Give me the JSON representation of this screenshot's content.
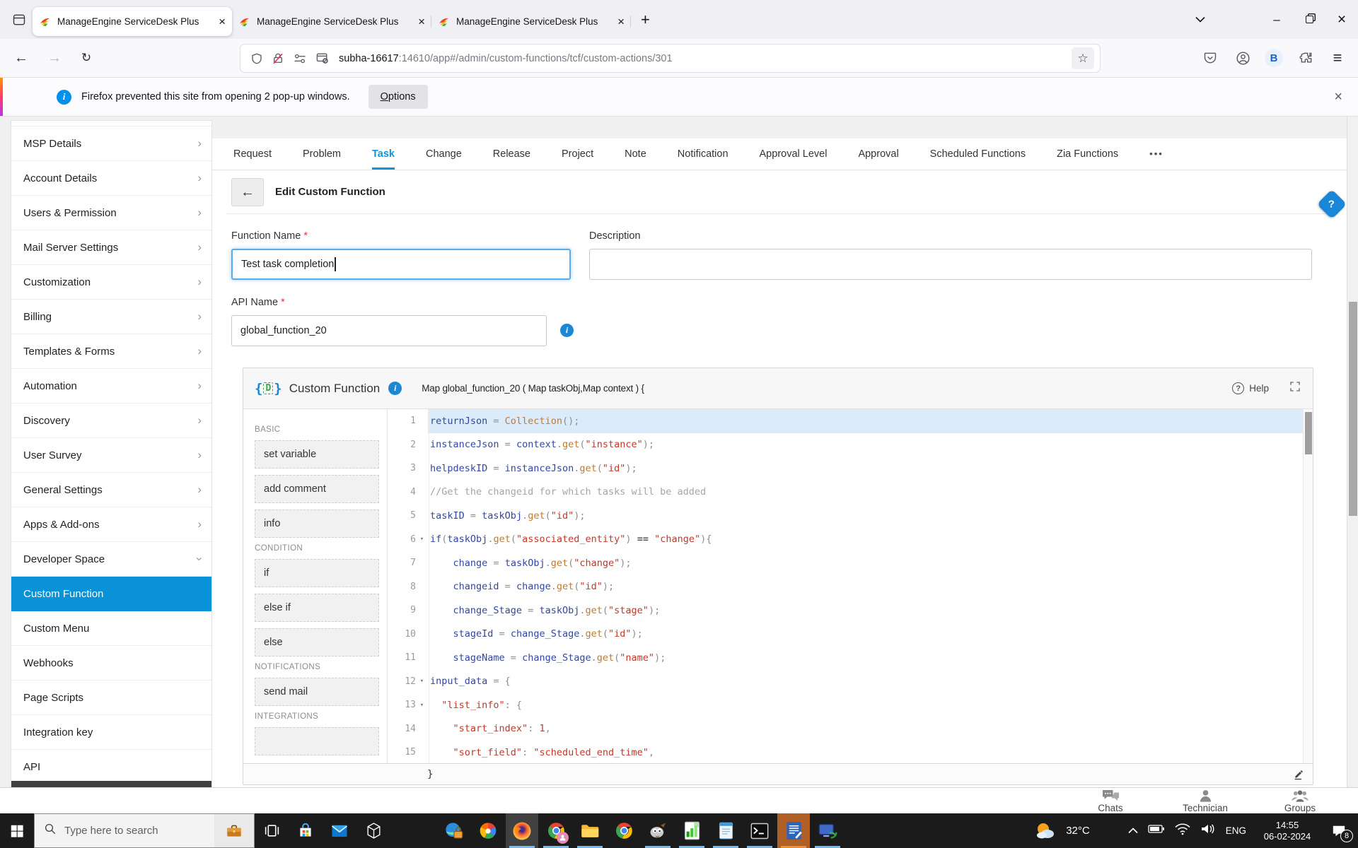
{
  "browser": {
    "tabs": [
      {
        "title": "ManageEngine ServiceDesk Plus",
        "active": true
      },
      {
        "title": "ManageEngine ServiceDesk Plus",
        "active": false
      },
      {
        "title": "ManageEngine ServiceDesk Plus",
        "active": false
      }
    ],
    "new_tab_label": "+",
    "url": {
      "host": "subha-16617",
      "rest": ":14610/app#/admin/custom-functions/tcf/custom-actions/301"
    },
    "notification": {
      "text": "Firefox prevented this site from opening 2 pop-up windows.",
      "options_label": "Options",
      "close_label": "×"
    },
    "window": {
      "minimize": "–",
      "close": "×"
    }
  },
  "sidebar": {
    "items": [
      {
        "label": "MSP Details",
        "chevron": "right"
      },
      {
        "label": "Account Details",
        "chevron": "right"
      },
      {
        "label": "Users & Permission",
        "chevron": "right"
      },
      {
        "label": "Mail Server Settings",
        "chevron": "right"
      },
      {
        "label": "Customization",
        "chevron": "right"
      },
      {
        "label": "Billing",
        "chevron": "right"
      },
      {
        "label": "Templates & Forms",
        "chevron": "right"
      },
      {
        "label": "Automation",
        "chevron": "right"
      },
      {
        "label": "Discovery",
        "chevron": "right"
      },
      {
        "label": "User Survey",
        "chevron": "right"
      },
      {
        "label": "General Settings",
        "chevron": "right"
      },
      {
        "label": "Apps & Add-ons",
        "chevron": "right"
      },
      {
        "label": "Developer Space",
        "chevron": "down"
      },
      {
        "label": "Custom Function",
        "active": true
      },
      {
        "label": "Custom Menu"
      },
      {
        "label": "Webhooks"
      },
      {
        "label": "Page Scripts"
      },
      {
        "label": "Integration key"
      },
      {
        "label": "API"
      }
    ]
  },
  "module_tabs": [
    {
      "label": "Request"
    },
    {
      "label": "Problem"
    },
    {
      "label": "Task",
      "active": true
    },
    {
      "label": "Change"
    },
    {
      "label": "Release"
    },
    {
      "label": "Project"
    },
    {
      "label": "Note"
    },
    {
      "label": "Notification"
    },
    {
      "label": "Approval Level"
    },
    {
      "label": "Approval"
    },
    {
      "label": "Scheduled Functions"
    },
    {
      "label": "Zia Functions"
    },
    {
      "label": "•••",
      "overflow": true
    }
  ],
  "page": {
    "title": "Edit Custom Function",
    "required_marker": "*",
    "function_name_label": "Function Name",
    "function_name_value": "Test task completion",
    "description_label": "Description",
    "description_value": "",
    "api_name_label": "API Name",
    "api_name_value": "global_function_20"
  },
  "editor": {
    "title": "Custom Function",
    "signature": "Map global_function_20 ( Map taskObj,Map context ) {",
    "help_label": "Help",
    "closing_brace": "}",
    "palette": [
      {
        "section": "BASIC",
        "buttons": [
          "set variable",
          "add comment",
          "info"
        ]
      },
      {
        "section": "CONDITION",
        "buttons": [
          "if",
          "else if",
          "else"
        ]
      },
      {
        "section": "NOTIFICATIONS",
        "buttons": [
          "send mail"
        ]
      },
      {
        "section": "INTEGRATIONS",
        "buttons": [
          ""
        ]
      }
    ],
    "lines": [
      {
        "n": 1,
        "hl": true,
        "t": [
          [
            "v",
            "returnJson"
          ],
          [
            "o",
            " = "
          ],
          [
            "m",
            "Collection"
          ],
          [
            "o",
            "();"
          ]
        ]
      },
      {
        "n": 2,
        "t": [
          [
            "v",
            "instanceJson"
          ],
          [
            "o",
            " = "
          ],
          [
            "v",
            "context"
          ],
          [
            "o",
            "."
          ],
          [
            "m",
            "get"
          ],
          [
            "o",
            "("
          ],
          [
            "s",
            "\"instance\""
          ],
          [
            "o",
            ");"
          ]
        ]
      },
      {
        "n": 3,
        "t": [
          [
            "v",
            "helpdeskID"
          ],
          [
            "o",
            " = "
          ],
          [
            "v",
            "instanceJson"
          ],
          [
            "o",
            "."
          ],
          [
            "m",
            "get"
          ],
          [
            "o",
            "("
          ],
          [
            "s",
            "\"id\""
          ],
          [
            "o",
            ");"
          ]
        ]
      },
      {
        "n": 4,
        "t": [
          [
            "c",
            "//Get the changeid for which tasks will be added"
          ]
        ]
      },
      {
        "n": 5,
        "t": [
          [
            "v",
            "taskID"
          ],
          [
            "o",
            " = "
          ],
          [
            "v",
            "taskObj"
          ],
          [
            "o",
            "."
          ],
          [
            "m",
            "get"
          ],
          [
            "o",
            "("
          ],
          [
            "s",
            "\"id\""
          ],
          [
            "o",
            ");"
          ]
        ]
      },
      {
        "n": 6,
        "fold": true,
        "t": [
          [
            "k",
            "if"
          ],
          [
            "o",
            "("
          ],
          [
            "v",
            "taskObj"
          ],
          [
            "o",
            "."
          ],
          [
            "m",
            "get"
          ],
          [
            "o",
            "("
          ],
          [
            "s",
            "\"associated_entity\""
          ],
          [
            "o",
            ") "
          ],
          [
            "b",
            "=="
          ],
          [
            "o",
            " "
          ],
          [
            "s",
            "\"change\""
          ],
          [
            "o",
            "){"
          ]
        ]
      },
      {
        "n": 7,
        "t": [
          [
            "o",
            "    "
          ],
          [
            "v",
            "change"
          ],
          [
            "o",
            " = "
          ],
          [
            "v",
            "taskObj"
          ],
          [
            "o",
            "."
          ],
          [
            "m",
            "get"
          ],
          [
            "o",
            "("
          ],
          [
            "s",
            "\"change\""
          ],
          [
            "o",
            ");"
          ]
        ]
      },
      {
        "n": 8,
        "t": [
          [
            "o",
            "    "
          ],
          [
            "v",
            "changeid"
          ],
          [
            "o",
            " = "
          ],
          [
            "v",
            "change"
          ],
          [
            "o",
            "."
          ],
          [
            "m",
            "get"
          ],
          [
            "o",
            "("
          ],
          [
            "s",
            "\"id\""
          ],
          [
            "o",
            ");"
          ]
        ]
      },
      {
        "n": 9,
        "t": [
          [
            "o",
            "    "
          ],
          [
            "v",
            "change_Stage"
          ],
          [
            "o",
            " = "
          ],
          [
            "v",
            "taskObj"
          ],
          [
            "o",
            "."
          ],
          [
            "m",
            "get"
          ],
          [
            "o",
            "("
          ],
          [
            "s",
            "\"stage\""
          ],
          [
            "o",
            ");"
          ]
        ]
      },
      {
        "n": 10,
        "t": [
          [
            "o",
            "    "
          ],
          [
            "v",
            "stageId"
          ],
          [
            "o",
            " = "
          ],
          [
            "v",
            "change_Stage"
          ],
          [
            "o",
            "."
          ],
          [
            "m",
            "get"
          ],
          [
            "o",
            "("
          ],
          [
            "s",
            "\"id\""
          ],
          [
            "o",
            ");"
          ]
        ]
      },
      {
        "n": 11,
        "t": [
          [
            "o",
            "    "
          ],
          [
            "v",
            "stageName"
          ],
          [
            "o",
            " = "
          ],
          [
            "v",
            "change_Stage"
          ],
          [
            "o",
            "."
          ],
          [
            "m",
            "get"
          ],
          [
            "o",
            "("
          ],
          [
            "s",
            "\"name\""
          ],
          [
            "o",
            ");"
          ]
        ]
      },
      {
        "n": 12,
        "fold": true,
        "t": [
          [
            "v",
            "input_data"
          ],
          [
            "o",
            " = {"
          ]
        ]
      },
      {
        "n": 13,
        "fold": true,
        "t": [
          [
            "o",
            "  "
          ],
          [
            "s",
            "\"list_info\""
          ],
          [
            "o",
            ": {"
          ]
        ]
      },
      {
        "n": 14,
        "t": [
          [
            "o",
            "    "
          ],
          [
            "s",
            "\"start_index\""
          ],
          [
            "o",
            ": "
          ],
          [
            "num",
            "1"
          ],
          [
            "o",
            ","
          ]
        ]
      },
      {
        "n": 15,
        "t": [
          [
            "o",
            "    "
          ],
          [
            "s",
            "\"sort_field\""
          ],
          [
            "o",
            ": "
          ],
          [
            "s",
            "\"scheduled_end_time\""
          ],
          [
            "o",
            ","
          ]
        ]
      }
    ]
  },
  "dock": {
    "items": [
      "Chats",
      "Technician",
      "Groups"
    ]
  },
  "taskbar": {
    "search_placeholder": "Type here to search",
    "apps": [
      {
        "name": "task-view"
      },
      {
        "name": "store"
      },
      {
        "name": "mail"
      },
      {
        "name": "viewer3d"
      },
      {
        "name": "gap"
      },
      {
        "name": "edge-lock"
      },
      {
        "name": "pinwheel"
      },
      {
        "name": "firefox",
        "running": true,
        "focused": true
      },
      {
        "name": "chrome-profile",
        "running": true
      },
      {
        "name": "explorer",
        "running": true
      },
      {
        "name": "chrome"
      },
      {
        "name": "gimp",
        "running": true
      },
      {
        "name": "calc",
        "running": true
      },
      {
        "name": "notepad",
        "running": true
      },
      {
        "name": "terminal",
        "running": true
      },
      {
        "name": "writer",
        "running": true,
        "highlight": "orange"
      },
      {
        "name": "remote",
        "running": true
      }
    ],
    "tray": {
      "temperature": "32°C",
      "language": "ENG",
      "time": "14:55",
      "date": "06-02-2024",
      "badge": "8"
    }
  }
}
